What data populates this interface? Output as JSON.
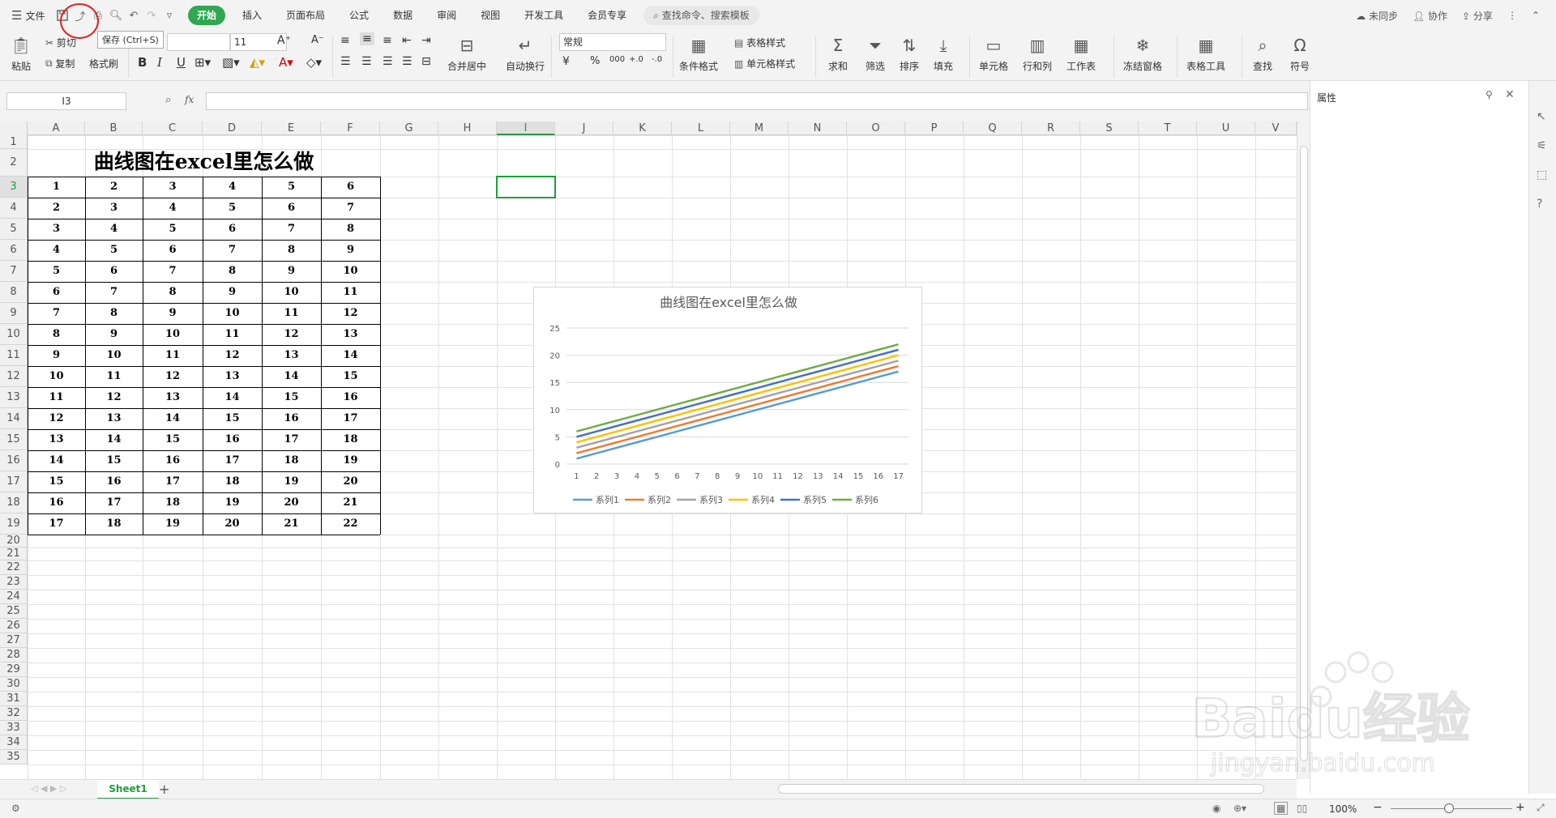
{
  "menubar": {
    "file_label": "文件",
    "tabs": [
      "开始",
      "插入",
      "页面布局",
      "公式",
      "数据",
      "审阅",
      "视图",
      "开发工具",
      "会员专享"
    ],
    "search_placeholder": "查找命令、搜索模板",
    "sync_label": "未同步",
    "collab_label": "协作",
    "share_label": "分享"
  },
  "tooltip": "保存 (Ctrl+S)",
  "ribbon": {
    "paste": "粘贴",
    "cut": "剪切",
    "copy": "复制",
    "format_painter": "格式刷",
    "font_size": "11",
    "number_format": "常规",
    "merge_center": "合并居中",
    "wrap_text": "自动换行",
    "cond_format": "条件格式",
    "table_style": "表格样式",
    "cell_style": "单元格样式",
    "sum": "求和",
    "filter": "筛选",
    "sort": "排序",
    "fill": "填充",
    "cell": "单元格",
    "row_col": "行和列",
    "worksheet": "工作表",
    "freeze": "冻结窗格",
    "table_tools": "表格工具",
    "find": "查找",
    "symbol": "符号",
    "bold": "B",
    "italic": "I",
    "underline": "U",
    "currency": "¥",
    "percent": "%",
    "thousands": "000",
    "dec_inc": "+.0",
    "dec_dec": "-.0"
  },
  "formula_bar": {
    "name_box": "I3",
    "fx": "fx",
    "value": ""
  },
  "right_panel": {
    "title": "属性"
  },
  "sheet": {
    "columns": [
      "A",
      "B",
      "C",
      "D",
      "E",
      "F",
      "G",
      "H",
      "I",
      "J",
      "K",
      "L",
      "M",
      "N",
      "O",
      "P",
      "Q",
      "R",
      "S",
      "T",
      "U",
      "V"
    ],
    "rows": [
      "1",
      "2",
      "3",
      "4",
      "5",
      "6",
      "7",
      "8",
      "9",
      "10",
      "11",
      "12",
      "13",
      "14",
      "15",
      "16",
      "17",
      "18",
      "19",
      "20",
      "21",
      "22",
      "23",
      "24",
      "25",
      "26",
      "27",
      "28",
      "29",
      "30",
      "31",
      "32",
      "33",
      "34",
      "35"
    ],
    "title": "曲线图在excel里怎么做",
    "data": [
      [
        1,
        2,
        3,
        4,
        5,
        6
      ],
      [
        2,
        3,
        4,
        5,
        6,
        7
      ],
      [
        3,
        4,
        5,
        6,
        7,
        8
      ],
      [
        4,
        5,
        6,
        7,
        8,
        9
      ],
      [
        5,
        6,
        7,
        8,
        9,
        10
      ],
      [
        6,
        7,
        8,
        9,
        10,
        11
      ],
      [
        7,
        8,
        9,
        10,
        11,
        12
      ],
      [
        8,
        9,
        10,
        11,
        12,
        13
      ],
      [
        9,
        10,
        11,
        12,
        13,
        14
      ],
      [
        10,
        11,
        12,
        13,
        14,
        15
      ],
      [
        11,
        12,
        13,
        14,
        15,
        16
      ],
      [
        12,
        13,
        14,
        15,
        16,
        17
      ],
      [
        13,
        14,
        15,
        16,
        17,
        18
      ],
      [
        14,
        15,
        16,
        17,
        18,
        19
      ],
      [
        15,
        16,
        17,
        18,
        19,
        20
      ],
      [
        16,
        17,
        18,
        19,
        20,
        21
      ],
      [
        17,
        18,
        19,
        20,
        21,
        22
      ]
    ]
  },
  "chart_data": {
    "type": "line",
    "title": "曲线图在excel里怎么做",
    "x": [
      1,
      2,
      3,
      4,
      5,
      6,
      7,
      8,
      9,
      10,
      11,
      12,
      13,
      14,
      15,
      16,
      17
    ],
    "ylim": [
      0,
      25
    ],
    "yticks": [
      0,
      5,
      10,
      15,
      20,
      25
    ],
    "grid": true,
    "legend": "bottom",
    "series": [
      {
        "name": "系列1",
        "color": "#5b9bd5",
        "values": [
          1,
          2,
          3,
          4,
          5,
          6,
          7,
          8,
          9,
          10,
          11,
          12,
          13,
          14,
          15,
          16,
          17
        ]
      },
      {
        "name": "系列2",
        "color": "#ed7d31",
        "values": [
          2,
          3,
          4,
          5,
          6,
          7,
          8,
          9,
          10,
          11,
          12,
          13,
          14,
          15,
          16,
          17,
          18
        ]
      },
      {
        "name": "系列3",
        "color": "#a5a5a5",
        "values": [
          3,
          4,
          5,
          6,
          7,
          8,
          9,
          10,
          11,
          12,
          13,
          14,
          15,
          16,
          17,
          18,
          19
        ]
      },
      {
        "name": "系列4",
        "color": "#ffc000",
        "values": [
          4,
          5,
          6,
          7,
          8,
          9,
          10,
          11,
          12,
          13,
          14,
          15,
          16,
          17,
          18,
          19,
          20
        ]
      },
      {
        "name": "系列5",
        "color": "#4472c4",
        "values": [
          5,
          6,
          7,
          8,
          9,
          10,
          11,
          12,
          13,
          14,
          15,
          16,
          17,
          18,
          19,
          20,
          21
        ]
      },
      {
        "name": "系列6",
        "color": "#70ad47",
        "values": [
          6,
          7,
          8,
          9,
          10,
          11,
          12,
          13,
          14,
          15,
          16,
          17,
          18,
          19,
          20,
          21,
          22
        ]
      }
    ]
  },
  "sheet_tabs": {
    "active": "Sheet1",
    "add": "+"
  },
  "status": {
    "zoom": "100%"
  },
  "watermark": {
    "text": "Baidu经验",
    "url": "jingyan.baidu.com"
  }
}
